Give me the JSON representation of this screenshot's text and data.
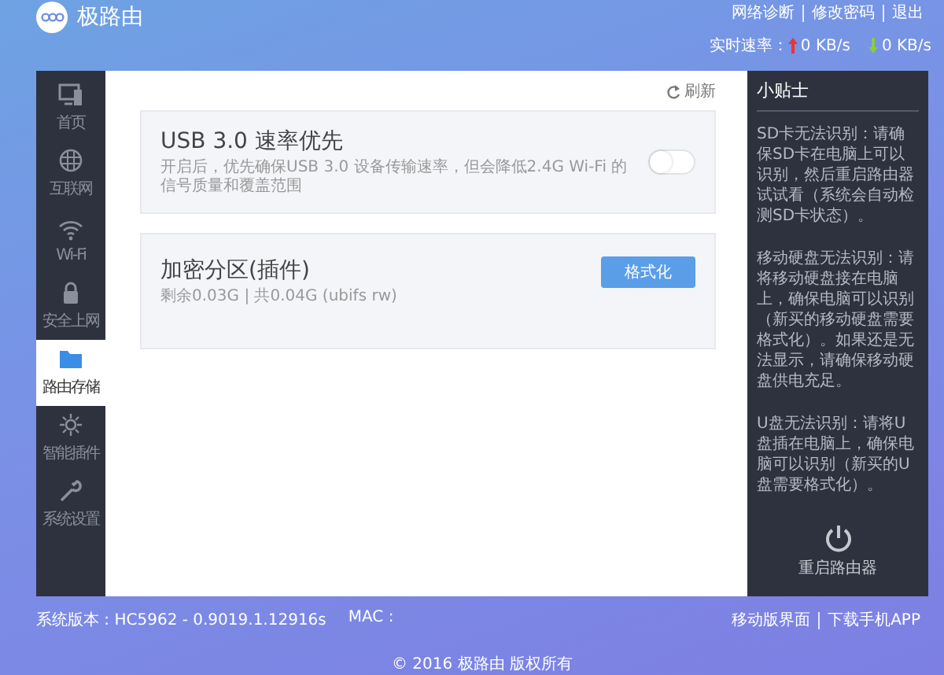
{
  "header": {
    "brand": "极路由",
    "links": [
      "网络诊断",
      "修改密码",
      "退出"
    ],
    "speed": {
      "label": "实时速率：",
      "upload": "0 KB/s",
      "download": "0 KB/s"
    }
  },
  "sidebar": {
    "items": [
      {
        "label": "首页",
        "selected": false
      },
      {
        "label": "互联网",
        "selected": false
      },
      {
        "label": "Wi-Fi",
        "selected": false
      },
      {
        "label": "安全上网",
        "selected": false
      },
      {
        "label": "路由存储",
        "selected": true
      },
      {
        "label": "智能插件",
        "selected": false
      },
      {
        "label": "系统设置",
        "selected": false
      }
    ]
  },
  "content": {
    "refresh": "刷新",
    "settings": [
      {
        "kind": "toggle",
        "title": "USB 3.0 速率优先",
        "description": "开启后，优先确保USB 3.0 设备传输速率，但会降低2.4G Wi-Fi 的信号质量和覆盖范围",
        "on": false
      },
      {
        "kind": "action",
        "title": "加密分区(插件)",
        "description": "剩余0.03G | 共0.04G (ubifs rw)",
        "button": "格式化"
      }
    ]
  },
  "tips": {
    "title": "小贴士",
    "paragraphs": [
      "SD卡无法识别：请确保SD卡在电脑上可以识别，然后重启路由器试试看（系统会自动检测SD卡状态）。",
      "移动硬盘无法识别：请将移动硬盘接在电脑上，确保电脑可以识别（新买的移动硬盘需要格式化）。如果还是无法显示，请确保移动硬盘供电充足。",
      "U盘无法识别：请将U盘插在电脑上，确保电脑可以识别（新买的U盘需要格式化）。"
    ],
    "reboot": "重启路由器"
  },
  "footer": {
    "version": "系统版本 : HC5962 - 0.9019.1.12916s",
    "mac": "MAC :",
    "links": [
      "移动版界面",
      "下载手机APP"
    ],
    "copyright": "© 2016 极路由 版权所有"
  }
}
